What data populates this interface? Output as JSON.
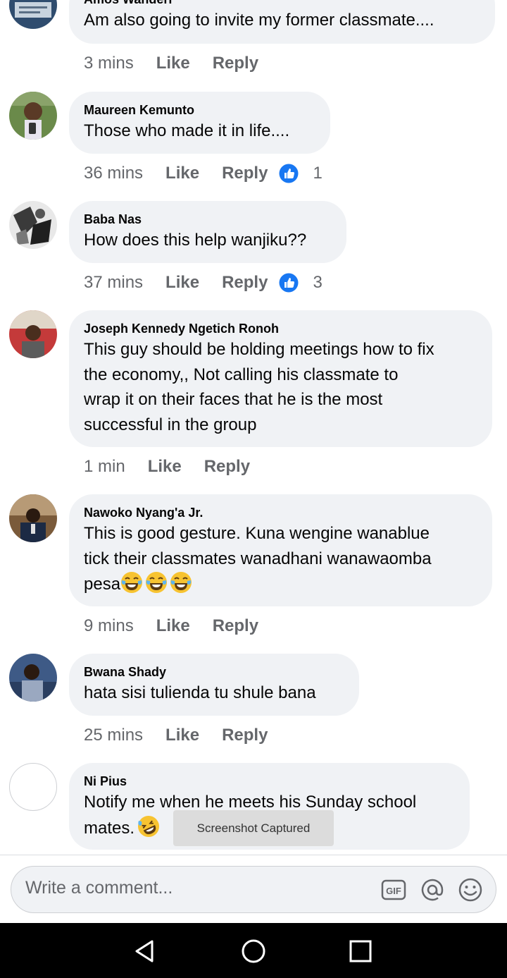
{
  "comments": [
    {
      "author": "Amos Wanderi",
      "text": "Am also going to invite my former classmate....",
      "time": "3 mins",
      "like_label": "Like",
      "reply_label": "Reply"
    },
    {
      "author": "Maureen Kemunto",
      "text": "Those who made it in life....",
      "time": "36 mins",
      "like_label": "Like",
      "reply_label": "Reply",
      "reaction_count": "1"
    },
    {
      "author": "Baba Nas",
      "text": "How does this help wanjiku??",
      "time": "37 mins",
      "like_label": "Like",
      "reply_label": "Reply",
      "reaction_count": "3"
    },
    {
      "author": "Joseph Kennedy Ngetich Ronoh",
      "lines": [
        "This guy should be holding meetings how to fix",
        "the economy,, Not calling his classmate to",
        "wrap it on their faces that he is the most",
        "successful in the group"
      ],
      "time": "1 min",
      "like_label": "Like",
      "reply_label": "Reply"
    },
    {
      "author": "Nawoko Nyang'a Jr.",
      "lines": [
        "This is good gesture. Kuna wengine wanablue",
        "tick their classmates wanadhani wanawaomba",
        "pesa"
      ],
      "emoji": "laughing-tears-emoji",
      "emoji_count": 3,
      "time": "9 mins",
      "like_label": "Like",
      "reply_label": "Reply"
    },
    {
      "author": "Bwana Shady",
      "text": "hata sisi tulienda tu shule bana",
      "time": "25 mins",
      "like_label": "Like",
      "reply_label": "Reply"
    },
    {
      "author": "Ni Pius",
      "lines": [
        "Notify me when he meets his Sunday school",
        "mates."
      ],
      "emoji": "rolling-laughing-emoji"
    }
  ],
  "toast": "Screenshot Captured",
  "composer": {
    "placeholder": "Write a comment...",
    "icons": [
      "gif-icon",
      "mention-icon",
      "emoji-icon"
    ]
  },
  "navbar": {
    "icons": [
      "back-icon",
      "home-icon",
      "recents-icon"
    ]
  },
  "colors": {
    "bubble": "#f0f2f5",
    "meta_text": "#65676b",
    "like_blue": "#1877f2",
    "navbar": "#000000"
  }
}
